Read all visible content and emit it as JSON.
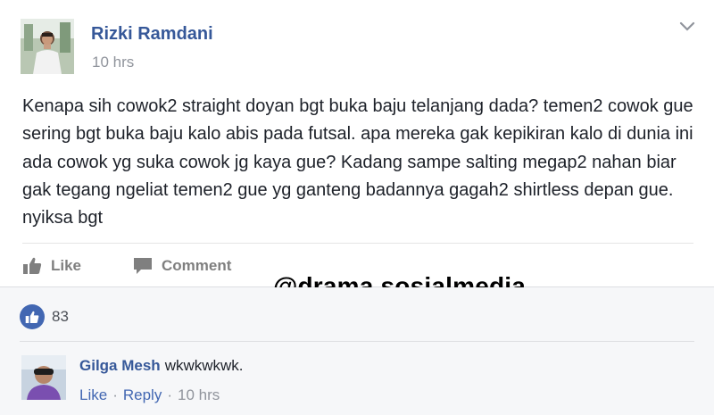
{
  "post": {
    "author": "Rizki Ramdani",
    "time": "10 hrs",
    "text": "Kenapa sih cowok2 straight doyan bgt buka baju telanjang dada? temen2 cowok gue sering bgt buka baju kalo abis pada futsal. apa mereka gak kepikiran kalo di dunia ini ada cowok yg suka cowok jg kaya gue? Kadang sampe salting megap2 nahan biar gak tegang ngeliat temen2 gue yg ganteng badannya gagah2 shirtless depan gue. nyiksa bgt",
    "like_label": "Like",
    "comment_label": "Comment",
    "menu_icon": "chevron-down-icon"
  },
  "watermark": "@drama.sosialmedia",
  "reactions": {
    "icon": "like-reaction-icon",
    "count": "83"
  },
  "comment": {
    "author": "Gilga Mesh",
    "text": "wkwkwkwk.",
    "like_label": "Like",
    "reply_label": "Reply",
    "separator": "·",
    "time": "10 hrs"
  },
  "colors": {
    "name_blue": "#365899",
    "link_blue": "#4267b2",
    "meta_gray": "#90949c",
    "comments_bg": "#f6f7f9"
  }
}
